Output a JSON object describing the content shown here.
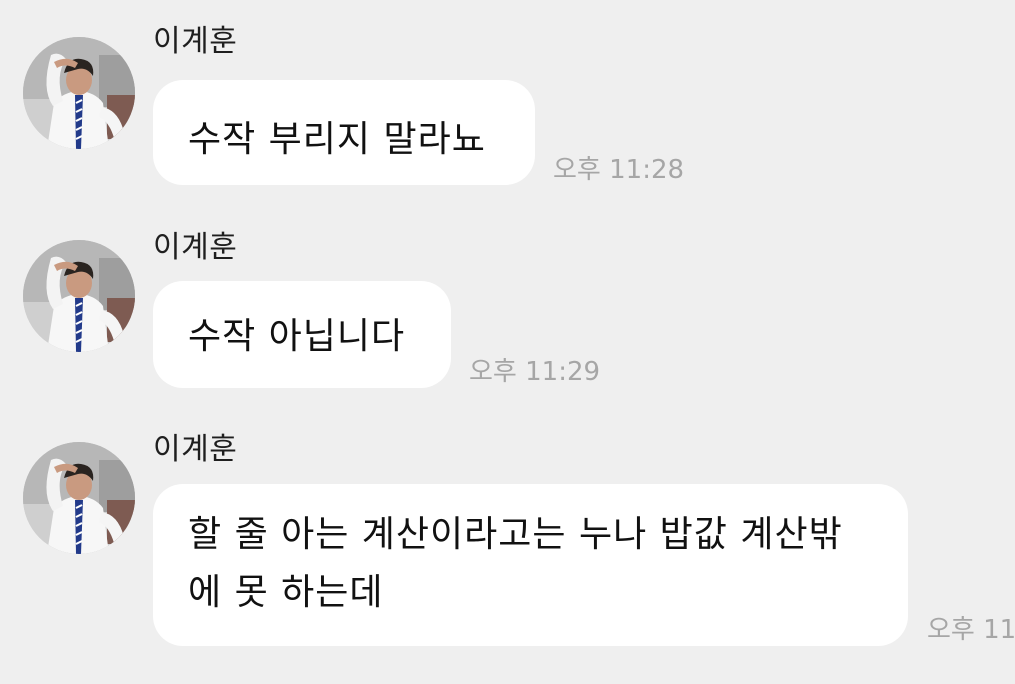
{
  "messages": [
    {
      "sender": "이계훈",
      "lines": [
        "수작 부리지 말라뇨"
      ],
      "time": "오후 11:28"
    },
    {
      "sender": "이계훈",
      "lines": [
        "수작 아닙니다"
      ],
      "time": "오후 11:29"
    },
    {
      "sender": "이계훈",
      "lines": [
        "할 줄 아는 계산이라고는 누나 밥값 계산밖",
        "에 못 하는데"
      ],
      "time": "오후 11:"
    }
  ],
  "colors": {
    "background": "#efefef",
    "bubble": "#ffffff",
    "text": "#111111",
    "timestamp": "#a6a6a6"
  },
  "icons": {
    "avatar": "profile-photo"
  }
}
